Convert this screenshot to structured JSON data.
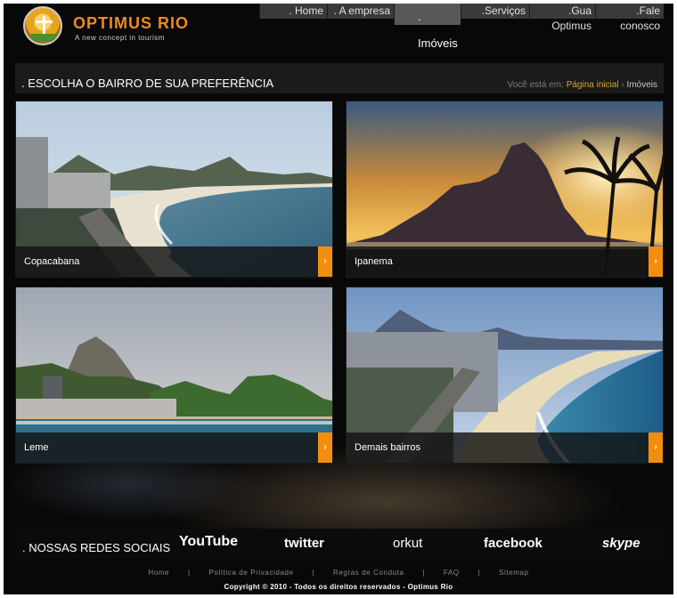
{
  "brand": {
    "name": "OPTIMUS RIO",
    "tagline": "A new concept in tourism"
  },
  "nav": {
    "items": [
      {
        "label": ". Home"
      },
      {
        "label": ". A empresa"
      },
      {
        "label": ". Imóveis",
        "active": true
      },
      {
        "label": ".Serviços"
      },
      {
        "label": ".Gua Optimus"
      },
      {
        "label": ".Fale conosco"
      }
    ]
  },
  "heading": {
    "title": ". ESCOLHA O BAIRRO DE SUA PREFERÊNCIA"
  },
  "breadcrumb": {
    "prefix": "Você está em:",
    "home": "Página inicial",
    "separator": "›",
    "current": "Imóveis"
  },
  "neighborhoods": [
    {
      "label": "Copacabana",
      "arrow": "›"
    },
    {
      "label": "Ipanema",
      "arrow": "›"
    },
    {
      "label": "Leme",
      "arrow": "›"
    },
    {
      "label": "Demais bairros",
      "arrow": "›"
    }
  ],
  "social": {
    "title": ". NOSSAS REDES SOCIAIS",
    "networks": [
      "YouTube",
      "twitter",
      "orkut",
      "facebook",
      "skype"
    ]
  },
  "footer": {
    "links": [
      "Home",
      "|",
      "Política de Privacidade",
      "|",
      "Regras de Conduta",
      "|",
      "FAQ",
      "|",
      "Sitemap"
    ],
    "copyright": "Copyright © 2010 - Todos os direitos reservados - Optimus Rio"
  },
  "colors": {
    "accent": "#f38d10",
    "background": "#060606",
    "link": "#d9a23a"
  }
}
